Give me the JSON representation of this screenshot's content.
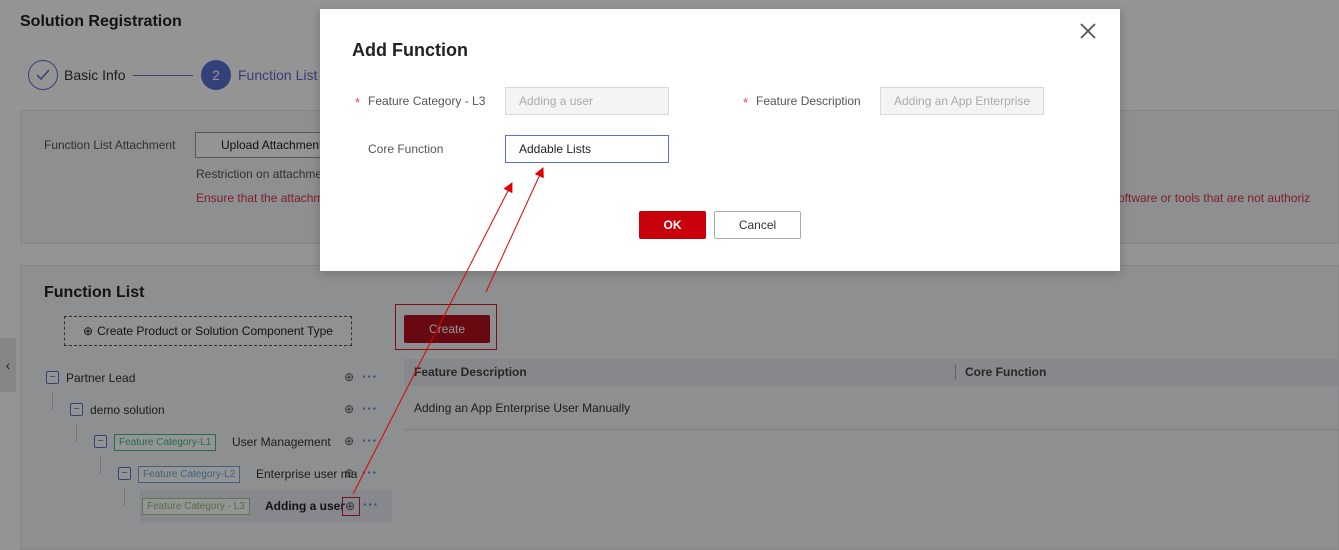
{
  "page": {
    "title": "Solution Registration",
    "steps": [
      {
        "label": "Basic Info",
        "state": "done"
      },
      {
        "number": "2",
        "label": "Function List",
        "state": "active"
      }
    ]
  },
  "attachment": {
    "label": "Function List Attachment",
    "upload_button": "Upload Attachment",
    "restriction": "Restriction on attachme",
    "warning_left": "Ensure that the attachm",
    "warning_right": "le), software or tools that are not authoriz"
  },
  "function_list": {
    "title": "Function List",
    "create_type_button": "Create Product or Solution Component Type",
    "create_button": "Create",
    "columns": [
      "Feature Description",
      "Core Function"
    ],
    "rows": [
      {
        "feature_description": "Adding an App Enterprise User Manually",
        "core_function": ""
      }
    ],
    "tree": {
      "partner_lead": "Partner Lead",
      "demo_solution": "demo solution",
      "l1_tag": "Feature Category-L1",
      "l1_text": "User Management",
      "l2_tag": "Feature Category-L2",
      "l2_text": "Enterprise user ma",
      "l3_tag": "Feature Category - L3",
      "l3_text": "Adding a user"
    },
    "collapse_icon": "chevron-left-icon"
  },
  "dialog": {
    "title": "Add Function",
    "feature_category_label": "Feature Category - L3",
    "feature_category_value": "Adding a user",
    "feature_description_label": "Feature Description",
    "feature_description_value": "Adding an App Enterprise",
    "core_function_label": "Core Function",
    "core_function_value": "Addable Lists",
    "ok_button": "OK",
    "cancel_button": "Cancel",
    "required_mark": "*",
    "close_icon": "close-icon"
  },
  "colors": {
    "accent": "#5b6fd1",
    "primary_button": "#c7000b",
    "warning_text": "#d9364a",
    "annotation_red": "#e00000"
  }
}
